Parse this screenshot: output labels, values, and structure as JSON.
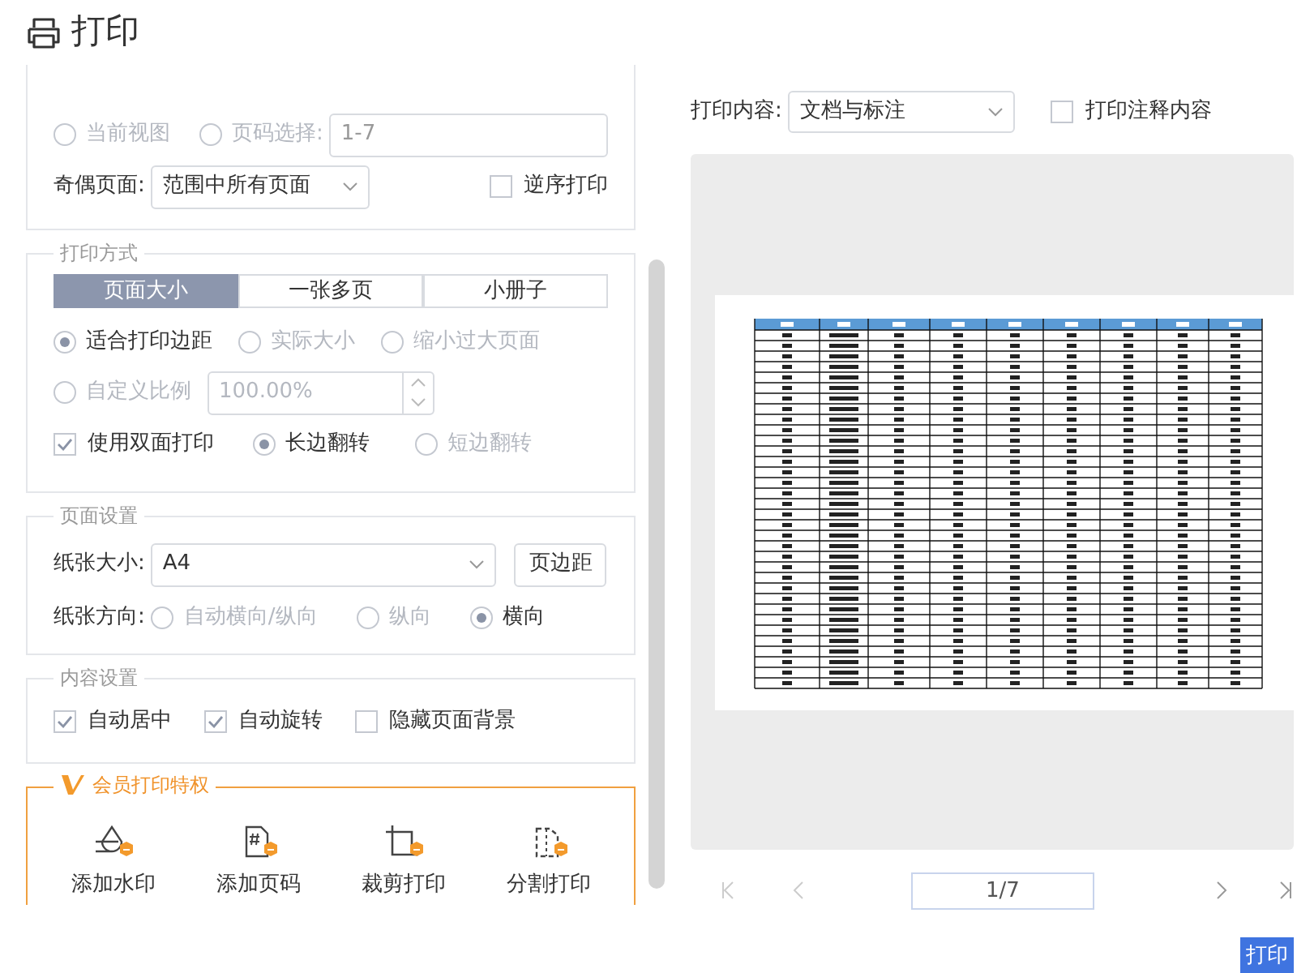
{
  "title": "打印",
  "range": {
    "options": [
      {
        "label": "当前视图",
        "selected": false,
        "disabled": true
      },
      {
        "label": "页码选择:",
        "selected": false,
        "disabled": true
      }
    ],
    "page_field": {
      "value": "1-7"
    },
    "odd_even": {
      "label": "奇偶页面:",
      "value": "范围中所有页面"
    },
    "reverse": {
      "label": "逆序打印",
      "checked": false
    }
  },
  "print_mode": {
    "legend": "打印方式",
    "tabs": [
      {
        "label": "页面大小",
        "selected": true
      },
      {
        "label": "一张多页",
        "selected": false
      },
      {
        "label": "小册子",
        "selected": false
      }
    ],
    "scale_options": [
      {
        "label": "适合打印边距",
        "selected": true,
        "disabled": false
      },
      {
        "label": "实际大小",
        "selected": false,
        "disabled": true
      },
      {
        "label": "缩小过大页面",
        "selected": false,
        "disabled": true
      }
    ],
    "custom": {
      "label": "自定义比例",
      "selected": false,
      "disabled": true,
      "value": "100.00%"
    },
    "duplex": {
      "label": "使用双面打印",
      "checked": true
    },
    "flip_options": [
      {
        "label": "长边翻转",
        "selected": true,
        "disabled": false
      },
      {
        "label": "短边翻转",
        "selected": false,
        "disabled": true
      }
    ]
  },
  "page_setup": {
    "legend": "页面设置",
    "paper_label": "纸张大小:",
    "paper_value": "A4",
    "margin_button": "页边距",
    "orientation_label": "纸张方向:",
    "orientations": [
      {
        "label": "自动横向/纵向",
        "selected": false,
        "disabled": true
      },
      {
        "label": "纵向",
        "selected": false,
        "disabled": true
      },
      {
        "label": "横向",
        "selected": true,
        "disabled": false
      }
    ]
  },
  "content_setup": {
    "legend": "内容设置",
    "options": [
      {
        "label": "自动居中",
        "checked": true
      },
      {
        "label": "自动旋转",
        "checked": true
      },
      {
        "label": "隐藏页面背景",
        "checked": false
      }
    ]
  },
  "vip": {
    "legend": "会员打印特权",
    "items": [
      {
        "label": "添加水印",
        "kind": "watermark"
      },
      {
        "label": "添加页码",
        "kind": "page_number"
      },
      {
        "label": "裁剪打印",
        "kind": "crop"
      },
      {
        "label": "分割打印",
        "kind": "split"
      }
    ]
  },
  "print_content": {
    "label": "打印内容:",
    "value": "文档与标注"
  },
  "annotations": {
    "label": "打印注释内容",
    "checked": false
  },
  "pager": {
    "value": "1/7"
  },
  "print_button": "打印"
}
